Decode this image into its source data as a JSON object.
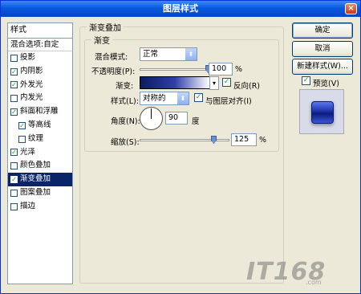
{
  "window": {
    "title": "图层样式",
    "close_glyph": "×"
  },
  "style_list": {
    "header": "样式",
    "blend_options": "混合选项:自定",
    "items": [
      {
        "label": "投影",
        "checked": false,
        "sub": false,
        "selected": false
      },
      {
        "label": "内阴影",
        "checked": true,
        "sub": false,
        "selected": false
      },
      {
        "label": "外发光",
        "checked": true,
        "sub": false,
        "selected": false
      },
      {
        "label": "内发光",
        "checked": false,
        "sub": false,
        "selected": false
      },
      {
        "label": "斜面和浮雕",
        "checked": true,
        "sub": false,
        "selected": false
      },
      {
        "label": "等高线",
        "checked": true,
        "sub": true,
        "selected": false
      },
      {
        "label": "纹理",
        "checked": false,
        "sub": true,
        "selected": false
      },
      {
        "label": "光泽",
        "checked": true,
        "sub": false,
        "selected": false
      },
      {
        "label": "颜色叠加",
        "checked": false,
        "sub": false,
        "selected": false
      },
      {
        "label": "渐变叠加",
        "checked": true,
        "sub": false,
        "selected": true
      },
      {
        "label": "图案叠加",
        "checked": false,
        "sub": false,
        "selected": false
      },
      {
        "label": "描边",
        "checked": false,
        "sub": false,
        "selected": false
      }
    ]
  },
  "panel": {
    "group_title": "渐变叠加",
    "subgroup_title": "渐变",
    "blend_mode_label": "混合模式:",
    "blend_mode_value": "正常",
    "opacity_label": "不透明度(P):",
    "opacity_value": "100",
    "opacity_unit": "%",
    "opacity_level": 1.0,
    "gradient_label": "渐变:",
    "reverse_label": "反向(R)",
    "reverse_checked": true,
    "style_label": "样式(L):",
    "style_value": "对称的",
    "align_label": "与图层对齐(I)",
    "align_checked": true,
    "angle_label": "角度(N):",
    "angle_value": "90",
    "angle_unit": "度",
    "scale_label": "缩放(S):",
    "scale_value": "125",
    "scale_unit": "%",
    "scale_level": 0.83
  },
  "buttons": {
    "ok": "确定",
    "cancel": "取消",
    "new_style": "新建样式(W)...",
    "preview_label": "预览(V)",
    "preview_checked": true
  },
  "watermark": {
    "brand": "IT168",
    "sub": ".com"
  },
  "colors": {
    "selection": "#0a246a",
    "titlebar": "#0a58e0",
    "gradient_start": "#0a1c5e"
  }
}
